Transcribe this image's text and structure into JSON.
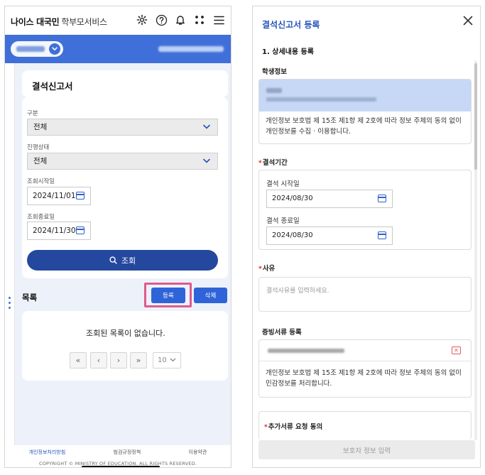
{
  "left_screen": {
    "header": {
      "brand_main": "나이스 대국민",
      "brand_sub": "학부모서비스",
      "icons": [
        "gear-icon",
        "help-icon",
        "bell-icon",
        "apps-icon",
        "menu-icon"
      ]
    },
    "page_title": "결석신고서",
    "filters": {
      "type_label": "구분",
      "type_value": "전체",
      "status_label": "진행상태",
      "status_value": "전체",
      "start_label": "조회시작일",
      "start_value": "2024/11/01",
      "end_label": "조회종료일",
      "end_value": "2024/11/30",
      "search_label": "조회"
    },
    "list": {
      "title": "목록",
      "register_label": "등록",
      "delete_label": "삭제",
      "empty_message": "조회된 목록이 없습니다.",
      "pager": {
        "first": "«",
        "prev": "‹",
        "next": "›",
        "last": "»",
        "page_size": "10"
      }
    },
    "footer": {
      "privacy": "개인정보처리방침",
      "email_policy": "범검규정정책",
      "terms": "이용약관",
      "copyright": "COPYRIGHT © MINISTRY OF EDUCATION. ALL RIGHTS RESERVED."
    },
    "colors": {
      "primary": "#3f6fd9",
      "highlight": "#e05a8a"
    }
  },
  "right_screen": {
    "title": "결석신고서 등록",
    "section_title": "1. 상세내용 등록",
    "student_info_label": "학생정보",
    "student_notice": "개인정보 보호법 제 15조 제1항 제 2호에 따라 정보 주체의 동의 없이 개인정보를 수집 · 이용합니다.",
    "period_label": "결석기간",
    "period_start_label": "결석 시작일",
    "period_start_value": "2024/08/30",
    "period_end_label": "결석 종료일",
    "period_end_value": "2024/08/30",
    "reason_label": "사유",
    "reason_placeholder": "결석사유를 입력하세요.",
    "docs_label": "증빙서류 등록",
    "docs_notice": "개인정보 보호법 제 15조 제1항 제 2호에 따라 정보 주체의 동의 없이 민감정보를 처리합니다.",
    "extra_docs_label": "추가서류 요청 동의",
    "submit_label": "보호자 정보 입력"
  }
}
